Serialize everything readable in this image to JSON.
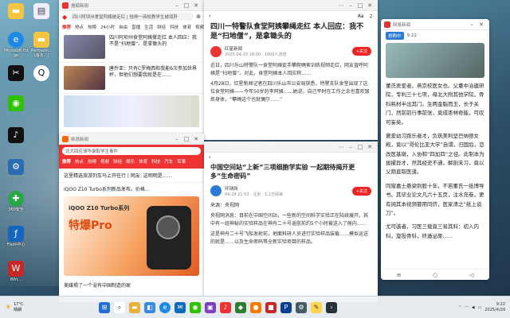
{
  "desktop": {
    "icons": [
      {
        "label": "",
        "icon": "folder-icon"
      },
      {
        "label": "",
        "icon": "document-icon"
      },
      {
        "label": "Microsoft Edge",
        "icon": "edge-icon"
      },
      {
        "label": "Piemazin...\n(版本...)",
        "icon": "folder-icon"
      },
      {
        "label": "",
        "icon": "capcut-icon"
      },
      {
        "label": "",
        "icon": "qq-icon"
      },
      {
        "label": "",
        "icon": "wechat-icon"
      },
      {
        "label": "",
        "icon": "tiktok-icon"
      },
      {
        "label": "",
        "icon": "settings-icon"
      },
      {
        "label": "360安全",
        "icon": "security-icon"
      },
      {
        "label": "Flash中心",
        "icon": "flash-icon"
      },
      {
        "label": "Win...",
        "icon": "app-icon"
      }
    ]
  },
  "window_news_list": {
    "title": "搜狐新闻",
    "search_text": "四川阿坝州食堂阿姨被走红 | 桂林一商校教学生被戏肝",
    "tabs": [
      "推荐",
      "热点",
      "热榜",
      "24小时",
      "自由",
      "直播",
      "生活",
      "财经",
      "科技",
      "体育",
      "视频"
    ],
    "items": [
      {
        "text": "四川阿坝州食堂阿姨撑走红 本人回应：我不是“扫地僧”，是拿锄头的",
        "meta": ""
      },
      {
        "text": "唐乔亚：只有C罗梅西和我能6次参加世界杯，但他们想要我就是在……",
        "meta": ""
      }
    ]
  },
  "window_news_list2": {
    "title": "新浪新闻",
    "search_text": "北大回应清华录取学生事件",
    "tabs": [
      "推荐",
      "热点",
      "热榜",
      "视频",
      "财经",
      "娱乐",
      "体育",
      "科技",
      "汽车",
      "军事"
    ],
    "headline": "这里精选旅游列车马上开往行 | 网友: 这明明是……",
    "promo_title": "iQOO Z10 Turbo系列新品发布。价格…",
    "promo_brand": "iQOO Z10 Turbo系列",
    "promo_tag": "特爆Pro",
    "item_text": "美媒揭了一个没有中国制造的家"
  },
  "window_article1": {
    "title": "四川一特警队食堂阿姨攀绳走红 本人回应：我不是“扫地僧”，是拿锄头的",
    "source": "红星新闻",
    "time": "2025-04-29 18:00 · 1000人浏览",
    "follow": "+关注",
    "paragraphs": [
      "近日，四川乐山特警队一食堂阿姨徒手攀爬绳索训练视频走红，网友直呼阿姨是“扫地僧”。对此，食堂阿姨本人回应称……",
      "4月28日，红星新闻记者在四川乐山市公安局获悉，特警支队食堂出现了这位食堂阿姨——今年50岁的李阿姨……她说，自己平时在工作之余也喜欢锻炼身体，“攀绳这个也就偶尔……”"
    ]
  },
  "window_article2": {
    "title": "中国空间站“上新”三项细胞学实验 一起期待揭开更多“生命密码”",
    "source": "环球网",
    "time": "04-28 21:53 · 北京 · 1.1万阅读",
    "follow": "+关注",
    "from": "来源：央视网",
    "paragraphs": [
      "央视网消息：目前在中国空间站，一些新的空间科学实验正在陆续展开。其中有一组神秘的实验样品在神舟二十号返航前约5个小时被送入了舱内……",
      "这是神舟二十号飞船发射前，地面科研人员进行实验样品装载……模拟运送的就是……以及生命密码等全新实验项目的样品。"
    ]
  },
  "window_phone": {
    "title": "网易新闻",
    "subtitle": "抢购中",
    "time": "9:22",
    "paragraphs": [
      "董氏衷爱者，燕京校医女也。父董中冶建研院，专利三十七项，母北大附其他学院，骨科耗材半出其门。生两金脂而玉，长于关门，然前前行事前张，竟成杏林奇能，可叹可妄矣。",
      "褒爱幼习跑乐者才，负筑美利坚巴纳德女殿，竟以“哥伦比亚大学”自谓。归国后，恋改医基墩，入协和“四加四”之径。此制本为拔擢异才，然其经史不通，解剖未习，竟以父荫直取医道。",
      "同窗嘉士悬梁刺股十年，不若董氏一纸博导书。其毕业论文凡六十五页，注水充卷，更有阅其本视频篡用同侪，医家清之“纸上谈刀”。",
      "尤可骇者，习医三载竟三易其科：初入内科，旋投骨科，终遁泌尿……"
    ]
  },
  "taskbar": {
    "weather_temp": "17°C",
    "weather_desc": "晴朗",
    "time": "9:22",
    "date": "2025/4/29",
    "icons": [
      "windows-icon",
      "search-icon",
      "files-icon",
      "store-icon",
      "browser-icon",
      "mail-icon",
      "chat-icon",
      "photos-icon",
      "music-icon",
      "app1-icon",
      "app2-icon",
      "app3-icon",
      "ps-icon",
      "tools-icon",
      "notes-icon",
      "terminal-icon"
    ]
  }
}
